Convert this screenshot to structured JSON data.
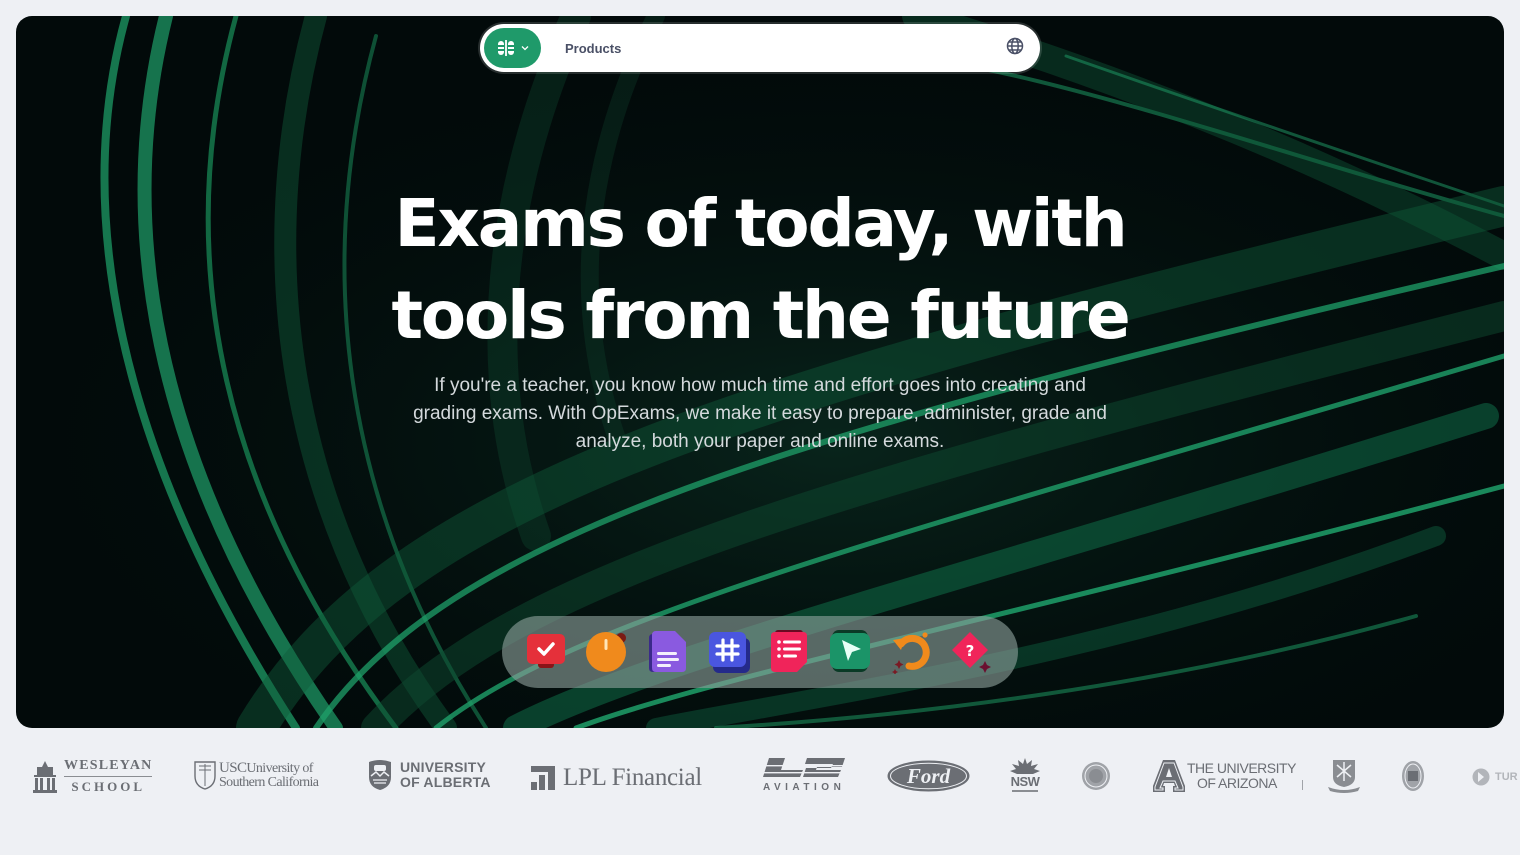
{
  "navbar": {
    "brand_icon": "opexams-logo-icon",
    "brand_menu_icon": "chevron-down-icon",
    "products_label": "Products",
    "language_icon": "globe-icon",
    "brand_color": "#1f9a6a"
  },
  "hero": {
    "headline_line1": "Exams of today, with",
    "headline_line2": "tools from the future",
    "subtitle_line1": "If you're a teacher, you know how much time and effort goes into creating and",
    "subtitle_line2": "grading exams. With OpExams, we make it easy to prepare, administer, grade and",
    "subtitle_line3": "analyze, both your paper and online exams."
  },
  "dock": {
    "apps": [
      {
        "name": "check-task-app",
        "icon": "checkmark-icon",
        "color": "#e5303a"
      },
      {
        "name": "timer-app",
        "icon": "stopwatch-icon",
        "color": "#f08a1c"
      },
      {
        "name": "document-app",
        "icon": "document-lines-icon",
        "color": "#8a5ae0"
      },
      {
        "name": "hashtag-app",
        "icon": "hashtag-icon",
        "color": "#4a56e0"
      },
      {
        "name": "list-app",
        "icon": "list-icon",
        "color": "#f0245a"
      },
      {
        "name": "cursor-app",
        "icon": "cursor-arrow-icon",
        "color": "#1b9468"
      },
      {
        "name": "refresh-app",
        "icon": "rotate-sparkle-icon",
        "color": "#f08a1c"
      },
      {
        "name": "question-app",
        "icon": "question-star-icon",
        "color": "#f0245a"
      }
    ]
  },
  "logos": {
    "wesleyan_top": "WESLEYAN",
    "wesleyan_bottom": "SCHOOL",
    "usc_abbr": "USC",
    "usc_line1": "University of",
    "usc_line2": "Southern California",
    "alberta_line1": "UNIVERSITY",
    "alberta_line2": "OF ALBERTA",
    "lpl": "LPL Financial",
    "l2_mark": "L2",
    "l2_sub": "AVIATION",
    "ford": "Ford",
    "nsw": "NSW",
    "arizona_line1": "THE UNIVERSITY",
    "arizona_line2": "OF ARIZONA",
    "partial": "TUR"
  }
}
